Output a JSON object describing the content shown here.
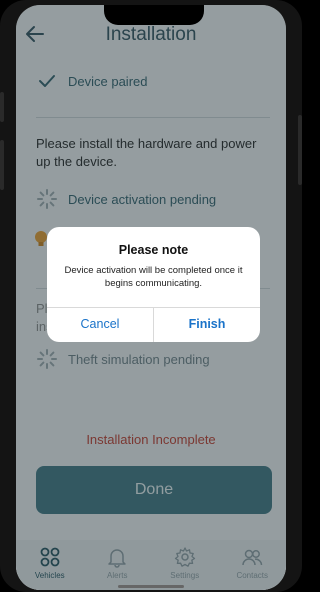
{
  "header": {
    "title": "Installation",
    "back_icon": "arrow-left-icon"
  },
  "steps": {
    "paired_label": "Device paired",
    "instruction": "Please install the hardware and power up the device.",
    "activation_label": "Device activation pending",
    "theft_label": "Theft simulation pending",
    "hidden_fragment_1": "Pl",
    "hidden_fragment_2": "ins"
  },
  "status": {
    "text": "Installation Incomplete",
    "color": "#c0392b"
  },
  "done_button": {
    "label": "Done"
  },
  "tabs": [
    {
      "label": "Vehicles",
      "icon": "vehicles-grid-icon",
      "active": true
    },
    {
      "label": "Alerts",
      "icon": "bell-icon",
      "active": false
    },
    {
      "label": "Settings",
      "icon": "gear-icon",
      "active": false
    },
    {
      "label": "Contacts",
      "icon": "people-icon",
      "active": false
    }
  ],
  "dialog": {
    "title": "Please note",
    "message": "Device activation will be completed once it begins communicating.",
    "cancel_label": "Cancel",
    "finish_label": "Finish"
  },
  "colors": {
    "accent": "#3d7480",
    "link": "#1a73c9"
  }
}
